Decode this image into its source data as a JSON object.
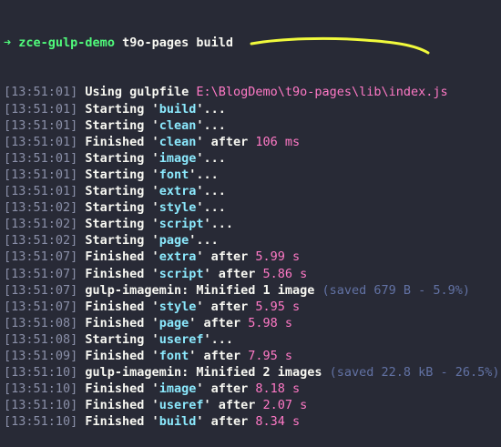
{
  "colors": {
    "background": "#282a36",
    "foreground": "#f8f8f2",
    "prompt": "#50fa7b",
    "timestamp": "#8a8fa8",
    "task": "#8be9fd",
    "time": "#ff79c6",
    "saved": "#6272a4",
    "annotation": "#f1fa3c"
  },
  "prompt": {
    "arrow": "➜",
    "directory": "zce-gulp-demo",
    "command": "t9o-pages build"
  },
  "lines": [
    {
      "ts": "[13:51:01]",
      "pre": " Using gulpfile ",
      "path": "E:\\BlogDemo\\t9o-pages\\lib\\index.js"
    },
    {
      "ts": "[13:51:01]",
      "pre": " Starting '",
      "task": "build",
      "post": "'..."
    },
    {
      "ts": "[13:51:01]",
      "pre": " Starting '",
      "task": "clean",
      "post": "'..."
    },
    {
      "ts": "[13:51:01]",
      "pre": " Finished '",
      "task": "clean",
      "post": "' after ",
      "time": "106 ms"
    },
    {
      "ts": "[13:51:01]",
      "pre": " Starting '",
      "task": "image",
      "post": "'..."
    },
    {
      "ts": "[13:51:01]",
      "pre": " Starting '",
      "task": "font",
      "post": "'..."
    },
    {
      "ts": "[13:51:01]",
      "pre": " Starting '",
      "task": "extra",
      "post": "'..."
    },
    {
      "ts": "[13:51:02]",
      "pre": " Starting '",
      "task": "style",
      "post": "'..."
    },
    {
      "ts": "[13:51:02]",
      "pre": " Starting '",
      "task": "script",
      "post": "'..."
    },
    {
      "ts": "[13:51:02]",
      "pre": " Starting '",
      "task": "page",
      "post": "'..."
    },
    {
      "ts": "[13:51:07]",
      "pre": " Finished '",
      "task": "extra",
      "post": "' after ",
      "time": "5.99 s"
    },
    {
      "ts": "[13:51:07]",
      "pre": " Finished '",
      "task": "script",
      "post": "' after ",
      "time": "5.86 s"
    },
    {
      "ts": "[13:51:07]",
      "pre": " gulp-imagemin: Minified 1 image ",
      "saved": "(saved 679 B - 5.9%)"
    },
    {
      "ts": "[13:51:07]",
      "pre": " Finished '",
      "task": "style",
      "post": "' after ",
      "time": "5.95 s"
    },
    {
      "ts": "[13:51:08]",
      "pre": " Finished '",
      "task": "page",
      "post": "' after ",
      "time": "5.98 s"
    },
    {
      "ts": "[13:51:08]",
      "pre": " Starting '",
      "task": "useref",
      "post": "'..."
    },
    {
      "ts": "[13:51:09]",
      "pre": " Finished '",
      "task": "font",
      "post": "' after ",
      "time": "7.95 s"
    },
    {
      "ts": "[13:51:10]",
      "pre": " gulp-imagemin: Minified 2 images ",
      "saved": "(saved 22.8 kB - 26.5%)"
    },
    {
      "ts": "[13:51:10]",
      "pre": " Finished '",
      "task": "image",
      "post": "' after ",
      "time": "8.18 s"
    },
    {
      "ts": "[13:51:10]",
      "pre": " Finished '",
      "task": "useref",
      "post": "' after ",
      "time": "2.07 s"
    },
    {
      "ts": "[13:51:10]",
      "pre": " Finished '",
      "task": "build",
      "post": "' after ",
      "time": "8.34 s"
    }
  ]
}
